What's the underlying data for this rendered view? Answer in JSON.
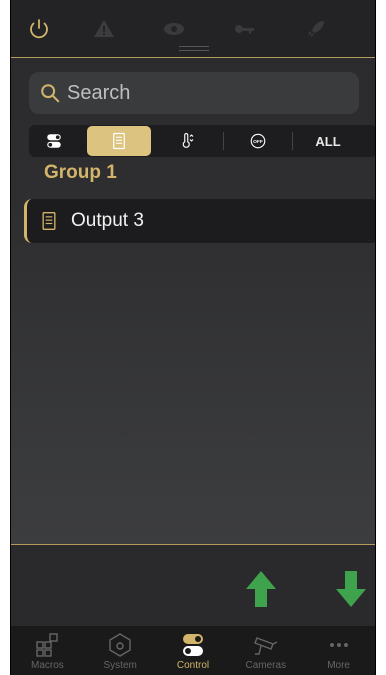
{
  "colors": {
    "accent": "#d2b46a",
    "accent_fill": "#dcc37f",
    "arrow_green": "#3fa34d",
    "text_primary": "#f2f2f2",
    "tab_inactive": "#666666"
  },
  "top_bar": {
    "icons": [
      "power-icon",
      "warning-icon",
      "eye-icon",
      "key-icon",
      "rocket-icon"
    ]
  },
  "search": {
    "placeholder": "Search",
    "value": ""
  },
  "filters": [
    {
      "id": "toggle",
      "icon": "toggle-switch-icon",
      "active": false
    },
    {
      "id": "output",
      "icon": "output-panel-icon",
      "active": true
    },
    {
      "id": "temperature",
      "icon": "thermometer-icon",
      "active": false
    },
    {
      "id": "off",
      "icon": "off-badge-icon",
      "active": false
    },
    {
      "id": "all",
      "label": "ALL",
      "active": false
    }
  ],
  "group": {
    "title": "Group 1",
    "items": [
      {
        "label": "Output 3",
        "icon": "output-panel-icon"
      }
    ]
  },
  "actions": {
    "up": "arrow-up-icon",
    "down": "arrow-down-icon"
  },
  "tabs": [
    {
      "label": "Macros",
      "icon": "macros-grid-icon",
      "active": false
    },
    {
      "label": "System",
      "icon": "system-shield-icon",
      "active": false
    },
    {
      "label": "Control",
      "icon": "control-toggle-icon",
      "active": true
    },
    {
      "label": "Cameras",
      "icon": "camera-icon",
      "active": false
    },
    {
      "label": "More",
      "icon": "more-dots-icon",
      "active": false
    }
  ]
}
